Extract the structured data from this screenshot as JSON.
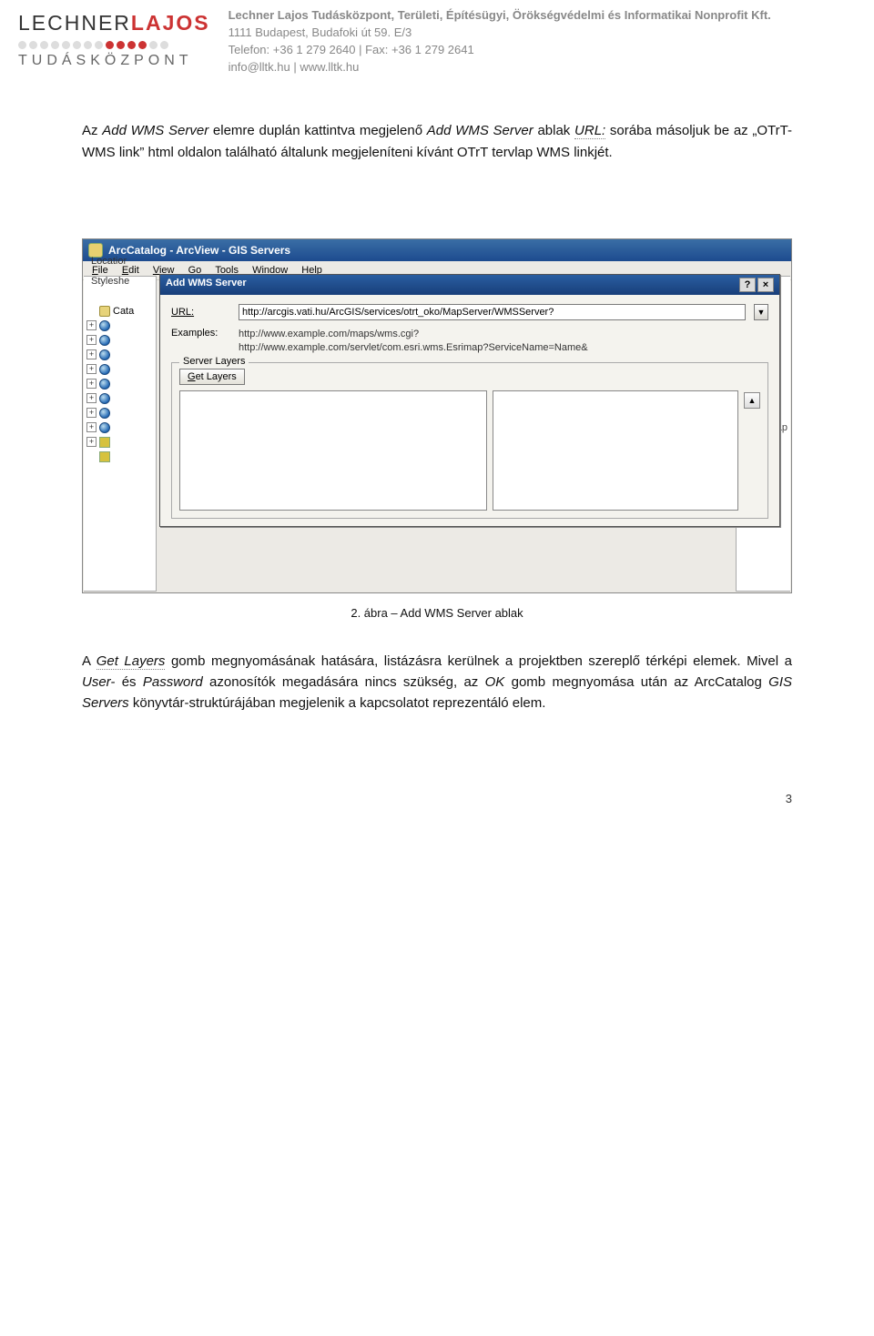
{
  "header": {
    "logo_top_a": "LECHNER",
    "logo_top_b": "LAJOS",
    "logo_sub": "TUDÁSKÖZPONT",
    "org": "Lechner Lajos Tudásközpont, Területi, Építésügyi, Örökségvédelmi és Informatikai Nonprofit Kft.",
    "addr": "1111 Budapest, Budafoki út 59. E/3",
    "phone": "Telefon: +36  1 279 2640 | Fax: +36  1 279 2641",
    "mail": "info@lltk.hu | www.lltk.hu"
  },
  "body": {
    "p1a": "Az ",
    "p1b": "Add WMS Server",
    "p1c": " elemre duplán kattintva megjelenő ",
    "p1d": "Add WMS Server",
    "p1e": " ablak ",
    "p1f": "URL:",
    "p1g": " sorába másoljuk be az „OTrT-WMS link” html oldalon található általunk megjeleníteni kívánt OTrT tervlap WMS linkjét.",
    "caption": "2. ábra – Add WMS Server ablak",
    "p2a": "A ",
    "p2b": "Get Layers",
    "p2c": " gomb megnyomásának hatására, listázásra kerülnek a projektben szereplő térképi elemek. Mivel a ",
    "p2d": "User-",
    "p2e": " és ",
    "p2f": "Password",
    "p2g": " azonosítók megadására nincs szükség, az ",
    "p2h": "OK",
    "p2i": " gomb megnyomása után az ArcCatalog ",
    "p2j": "GIS Servers",
    "p2k": " könyvtár-struktúrájában megjelenik a kapcsolatot reprezentáló elem.",
    "pagenum": "3"
  },
  "app": {
    "title": "ArcCatalog - ArcView - GIS Servers",
    "menus": {
      "file": "File",
      "edit": "Edit",
      "view": "View",
      "go": "Go",
      "tools": "Tools",
      "window": "Window",
      "help": "Help"
    },
    "left_labels": {
      "location": "Locatior",
      "stylesheet": "Styleshe"
    },
    "right_label": "w.geograp",
    "tree_label": "Cata"
  },
  "dialog": {
    "title": "Add WMS Server",
    "help_btn": "?",
    "close_btn": "×",
    "url_label": "URL:",
    "url_value": "http://arcgis.vati.hu/ArcGIS/services/otrt_oko/MapServer/WMSServer?",
    "examples_label": "Examples:",
    "example1": "http://www.example.com/maps/wms.cgi?",
    "example2": "http://www.example.com/servlet/com.esri.wms.Esrimap?ServiceName=Name&",
    "server_layers_legend": "Server Layers",
    "get_layers_btn": "Get Layers",
    "up_btn": "▲"
  }
}
